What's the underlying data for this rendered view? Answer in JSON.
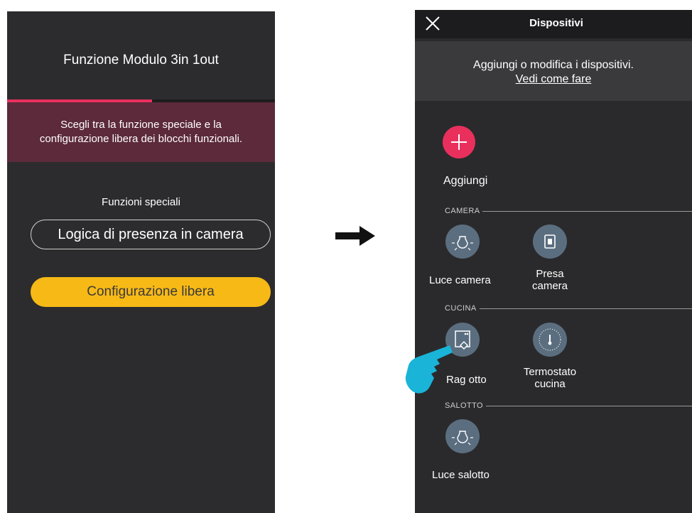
{
  "left": {
    "title": "Funzione Modulo 3in 1out",
    "progress_fraction": 0.54,
    "info_line1": "Scegli tra la funzione speciale e la",
    "info_line2": "configurazione libera dei blocchi funzionali.",
    "section_label": "Funzioni speciali",
    "option_presence": "Logica di presenza in camera",
    "option_free_config": "Configurazione libera",
    "colors": {
      "accent": "#e9305d",
      "primary_button": "#f7b916",
      "banner": "#5c2a3b",
      "background": "#2c2c2e"
    }
  },
  "right": {
    "title": "Dispositivi",
    "hint_line1": "Aggiungi o modifica i dispositivi.",
    "hint_link": "Vedi come fare",
    "add_label": "Aggiungi",
    "groups": [
      {
        "name": "CAMERA",
        "devices": [
          {
            "label": "Luce camera",
            "icon": "light-bulb-icon"
          },
          {
            "label_line1": "Presa",
            "label_line2": "camera",
            "icon": "socket-icon"
          }
        ]
      },
      {
        "name": "CUCINA",
        "devices": [
          {
            "label": "Rag otto",
            "icon": "module-icon"
          },
          {
            "label_line1": "Termostato",
            "label_line2": "cucina",
            "icon": "thermostat-icon"
          }
        ]
      },
      {
        "name": "SALOTTO",
        "devices": [
          {
            "label": "Luce salotto",
            "icon": "light-bulb-icon"
          }
        ]
      }
    ],
    "colors": {
      "add_button": "#e9305d",
      "device_icon_bg": "#5b6e80",
      "hand": "#19b4d8"
    }
  }
}
